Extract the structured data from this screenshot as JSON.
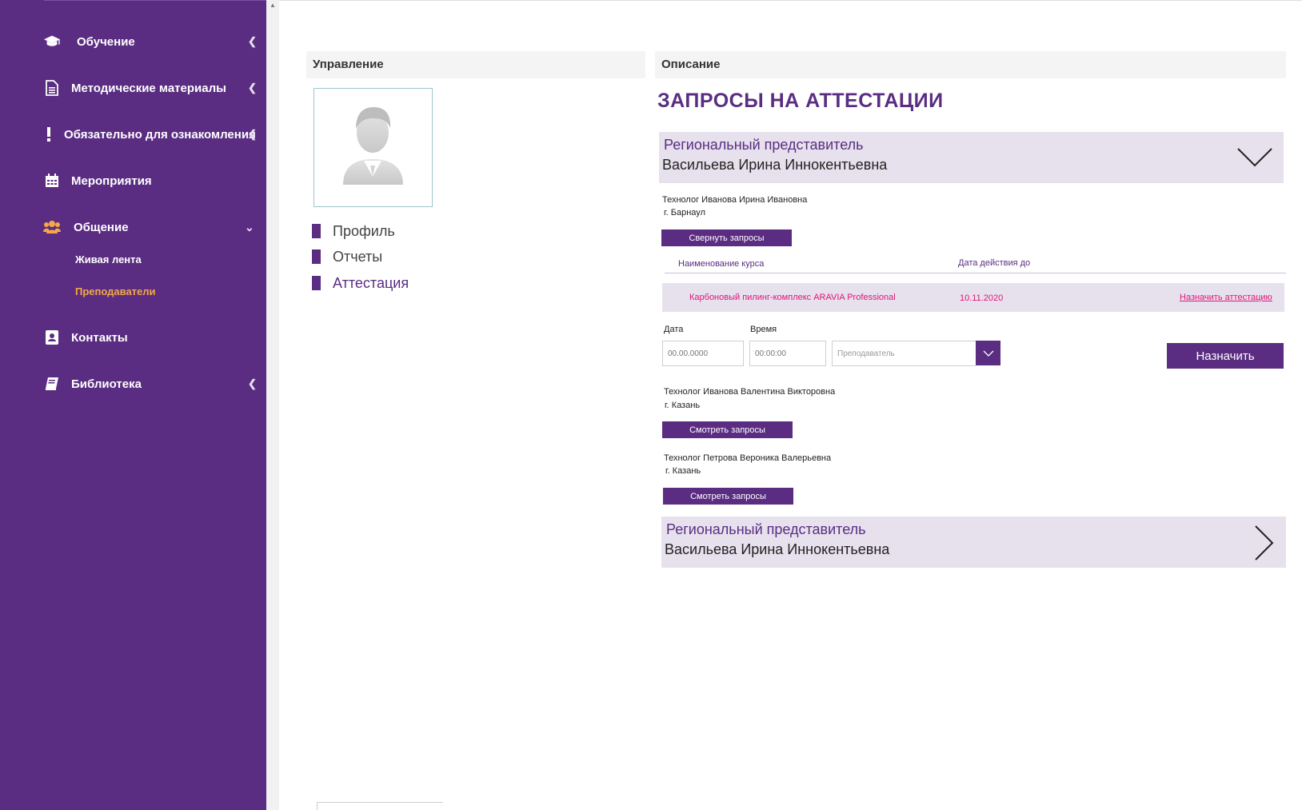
{
  "sidebar": {
    "items": [
      {
        "label": "Обучение",
        "icon": "graduation-cap-icon"
      },
      {
        "label": "Методические материалы",
        "icon": "document-icon"
      },
      {
        "label": "Обязательно для ознакомления",
        "icon": "exclamation-icon"
      },
      {
        "label": "Мероприятия",
        "icon": "calendar-icon"
      },
      {
        "label": "Общение",
        "icon": "users-icon"
      },
      {
        "label": "Контакты",
        "icon": "contact-book-icon"
      },
      {
        "label": "Библиотека",
        "icon": "book-icon"
      }
    ],
    "subitems": [
      {
        "label": "Живая лента"
      },
      {
        "label": "Преподаватели",
        "active": true
      }
    ]
  },
  "left_panel": {
    "title": "Управление",
    "menu": [
      {
        "label": "Профиль"
      },
      {
        "label": "Отчеты"
      },
      {
        "label": "Аттестация",
        "active": true
      }
    ]
  },
  "right_panel": {
    "title": "Описание",
    "page_title": "ЗАПРОСЫ НА АТТЕСТАЦИИ",
    "rep1": {
      "role": "Региональный представитель",
      "name": "Васильева Ирина Иннокентьевна"
    },
    "tech1": {
      "line": "Технолог  Иванова Ирина Ивановна",
      "city": "г. Барнаул",
      "button": "Свернуть  запросы"
    },
    "table": {
      "col_course": "Наименование курса",
      "col_date": "Дата действия до",
      "row": {
        "course": "Карбоновый пилинг-комплекс ARAVIA Professional",
        "date": "10.11.2020",
        "action": "Назначить аттестацию"
      }
    },
    "form": {
      "date_label": "Дата",
      "time_label": "Время",
      "date_placeholder": "00.00.0000",
      "time_placeholder": "00:00:00",
      "teacher_placeholder": "Преподаватель",
      "assign_button": "Назначить"
    },
    "tech2": {
      "line": "Технолог  Иванова Валентина Викторовна",
      "city": "г. Казань",
      "button": "Смотреть запросы"
    },
    "tech3": {
      "line": "Технолог  Петрова Вероника Валерьевна",
      "city": "г. Казань",
      "button": "Смотреть запросы"
    },
    "rep2": {
      "role": "Региональный представитель",
      "name": "Васильева Ирина Иннокентьевна"
    }
  },
  "colors": {
    "brand_purple": "#5a2d82",
    "accent_orange": "#f5a845",
    "pink": "#e0147a",
    "light_purple_bg": "#e7e1ed"
  }
}
